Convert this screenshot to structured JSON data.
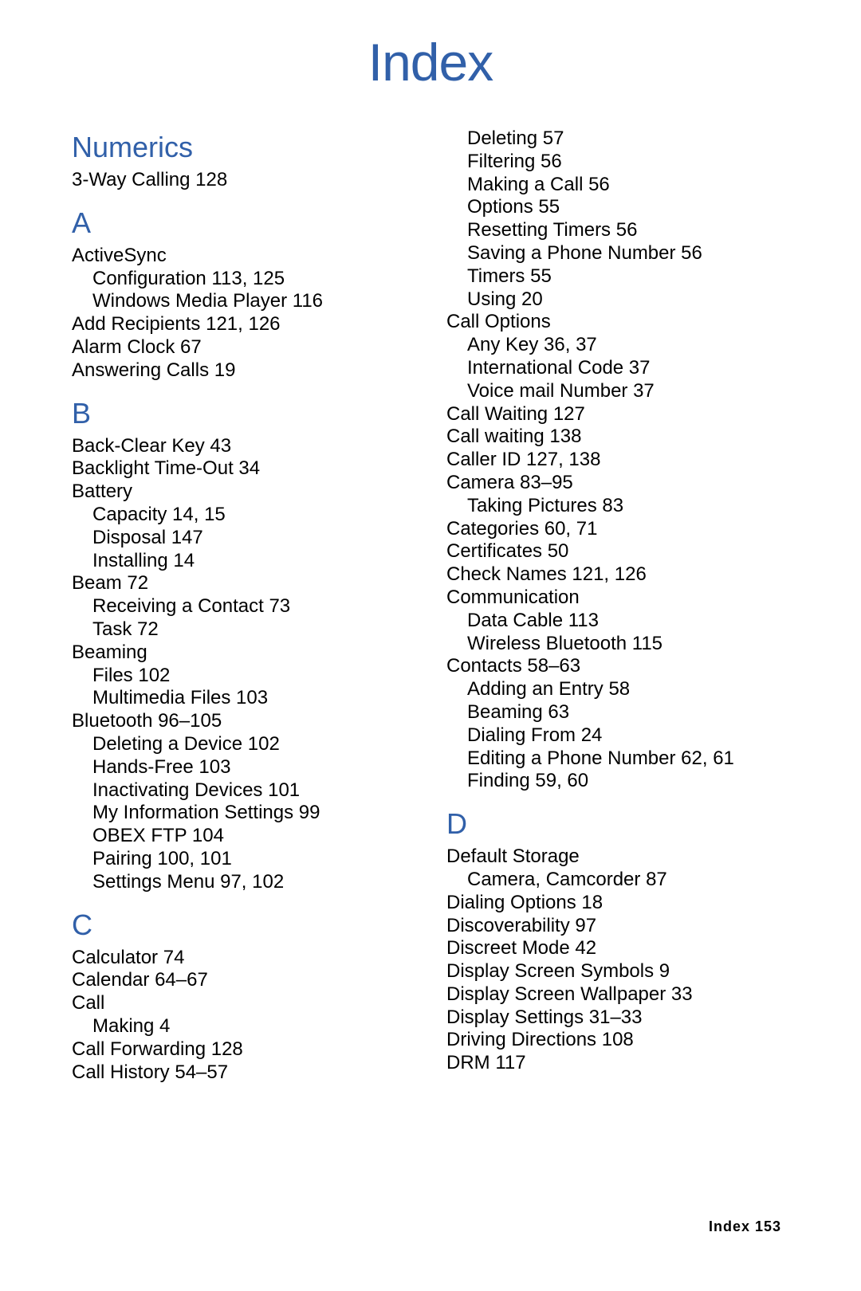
{
  "title": "Index",
  "col1": {
    "numerics": {
      "heading": "Numerics",
      "e1": "3-Way Calling 128"
    },
    "A": {
      "heading": "A",
      "e1": "ActiveSync",
      "e1a": "Configuration 113, 125",
      "e1b": "Windows Media Player 116",
      "e2": "Add Recipients 121, 126",
      "e3": "Alarm Clock 67",
      "e4": "Answering Calls 19"
    },
    "B": {
      "heading": "B",
      "e1": "Back-Clear Key 43",
      "e2": "Backlight Time-Out 34",
      "e3": "Battery",
      "e3a": "Capacity 14, 15",
      "e3b": "Disposal 147",
      "e3c": "Installing 14",
      "e4": "Beam 72",
      "e4a": "Receiving a Contact 73",
      "e4b": "Task 72",
      "e5": "Beaming",
      "e5a": "Files 102",
      "e5b": "Multimedia Files 103",
      "e6": "Bluetooth 96–105",
      "e6a": "Deleting a Device 102",
      "e6b": "Hands-Free 103",
      "e6c": "Inactivating Devices 101",
      "e6d": "My Information Settings 99",
      "e6e": "OBEX FTP 104",
      "e6f": "Pairing 100, 101",
      "e6g": "Settings Menu 97, 102"
    },
    "C": {
      "heading": "C",
      "e1": "Calculator 74",
      "e2": "Calendar 64–67",
      "e3": "Call",
      "e3a": "Making 4",
      "e4": "Call Forwarding 128",
      "e5": "Call History 54–57"
    }
  },
  "col2": {
    "cont": {
      "e1": "Deleting 57",
      "e2": "Filtering 56",
      "e3": "Making a Call 56",
      "e4": "Options 55",
      "e5": "Resetting Timers 56",
      "e6": "Saving a Phone Number 56",
      "e7": "Timers 55",
      "e8": "Using 20",
      "f1": "Call Options",
      "f1a": "Any Key 36, 37",
      "f1b": "International Code 37",
      "f1c": "Voice mail Number 37",
      "g1": "Call Waiting 127",
      "g2": "Call waiting 138",
      "g3": "Caller ID 127, 138",
      "g4": "Camera 83–95",
      "g4a": "Taking Pictures 83",
      "g5": "Categories 60, 71",
      "g6": "Certificates 50",
      "g7": "Check Names 121, 126",
      "g8": "Communication",
      "g8a": "Data Cable 113",
      "g8b": "Wireless Bluetooth 115",
      "g9": "Contacts 58–63",
      "g9a": "Adding an Entry 58",
      "g9b": "Beaming 63",
      "g9c": "Dialing From 24",
      "g9d": "Editing a Phone Number 62, 61",
      "g9e": "Finding 59, 60"
    },
    "D": {
      "heading": "D",
      "e1": "Default Storage",
      "e1a": "Camera, Camcorder 87",
      "e2": "Dialing Options 18",
      "e3": "Discoverability 97",
      "e4": "Discreet Mode 42",
      "e5": "Display Screen Symbols 9",
      "e6": "Display Screen Wallpaper 33",
      "e7": "Display Settings 31–33",
      "e8": "Driving Directions 108",
      "e9": "DRM 117"
    }
  },
  "footer": "Index  153"
}
